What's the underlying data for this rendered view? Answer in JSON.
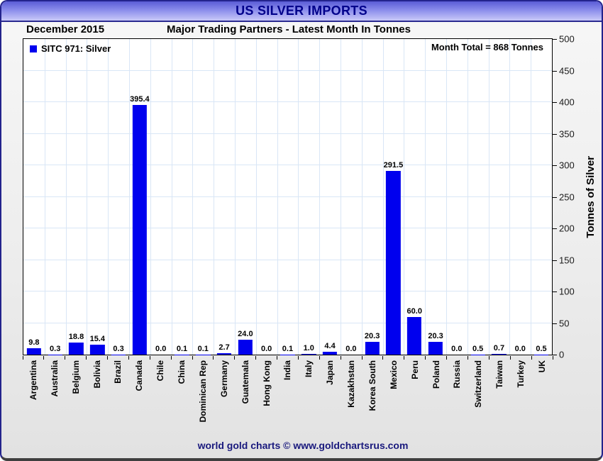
{
  "window": {
    "title": "US SILVER IMPORTS"
  },
  "header": {
    "date_label": "December 2015",
    "subtitle": "Major Trading Partners - Latest Month In Tonnes"
  },
  "legend": {
    "label": "SITC 971: Silver",
    "marker_color": "#0000ee"
  },
  "annotations": {
    "month_total": "Month Total = 868 Tonnes"
  },
  "axes": {
    "y_label": "Tonnes of Silver"
  },
  "footer": {
    "credit": "world gold charts © www.goldchartsrus.com"
  },
  "colors": {
    "bar": "#0000ee",
    "grid": "#d9e6f6",
    "title_text": "#00008b",
    "footer_text": "#19197d",
    "titlebar_gradient_top": "#5a5cd6",
    "titlebar_gradient_bottom": "#c9c9f8"
  },
  "chart_data": {
    "type": "bar",
    "title": "US SILVER IMPORTS",
    "subtitle": "Major Trading Partners - Latest Month In Tonnes",
    "period": "December 2015",
    "categories": [
      "Argentina",
      "Australia",
      "Belgium",
      "Bolivia",
      "Brazil",
      "Canada",
      "Chile",
      "China",
      "Dominican Rep",
      "Germany",
      "Guatemala",
      "Hong Kong",
      "India",
      "Italy",
      "Japan",
      "Kazakhstan",
      "Korea South",
      "Mexico",
      "Peru",
      "Poland",
      "Russia",
      "Switzerland",
      "Taiwan",
      "Turkey",
      "UK"
    ],
    "values": [
      9.8,
      0.3,
      18.8,
      15.4,
      0.3,
      395.4,
      0.0,
      0.1,
      0.1,
      2.7,
      24.0,
      0.0,
      0.1,
      1.0,
      4.4,
      0.0,
      20.3,
      291.5,
      60.0,
      20.3,
      0.0,
      0.5,
      0.7,
      0.0,
      0.5
    ],
    "value_labels": [
      "9.8",
      "0.3",
      "18.8",
      "15.4",
      "0.3",
      "395.4",
      "0.0",
      "0.1",
      "0.1",
      "2.7",
      "24.0",
      "0.0",
      "0.1",
      "1.0",
      "4.4",
      "0.0",
      "20.3",
      "291.5",
      "60.0",
      "20.3",
      "0.0",
      "0.5",
      "0.7",
      "0.0",
      "0.5"
    ],
    "xlabel": "",
    "ylabel": "Tonnes of Silver",
    "ylim": [
      0,
      500
    ],
    "y_tick_step": 50,
    "y_ticks": [
      0,
      50,
      100,
      150,
      200,
      250,
      300,
      350,
      400,
      450,
      500
    ],
    "legend": [
      "SITC 971: Silver"
    ],
    "legend_position": "top-left",
    "grid": true,
    "month_total_tonnes": 868
  }
}
